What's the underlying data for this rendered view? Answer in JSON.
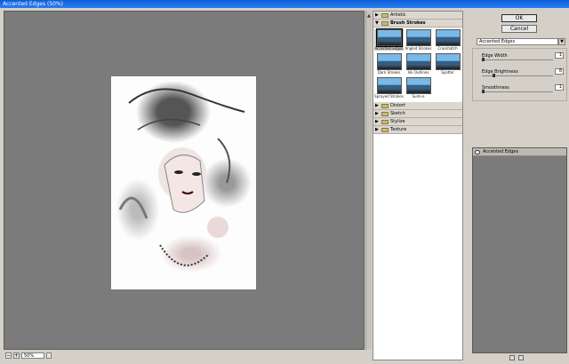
{
  "window": {
    "title": "Accented Edges (50%)"
  },
  "preview": {
    "zoom_minus": "−",
    "zoom_plus": "+",
    "zoom_value": "50%"
  },
  "filters": {
    "categories": [
      {
        "label": "Artistic",
        "expanded": false
      },
      {
        "label": "Brush Strokes",
        "expanded": true
      },
      {
        "label": "Distort",
        "expanded": false
      },
      {
        "label": "Sketch",
        "expanded": false
      },
      {
        "label": "Stylize",
        "expanded": false
      },
      {
        "label": "Texture",
        "expanded": false
      }
    ],
    "brush_strokes": [
      {
        "label": "Accented Edges",
        "selected": true
      },
      {
        "label": "Angled Strokes",
        "selected": false
      },
      {
        "label": "Crosshatch",
        "selected": false
      },
      {
        "label": "Dark Strokes",
        "selected": false
      },
      {
        "label": "Ink Outlines",
        "selected": false
      },
      {
        "label": "Spatter",
        "selected": false
      },
      {
        "label": "Sprayed Strokes",
        "selected": false
      },
      {
        "label": "Sumi-e",
        "selected": false
      }
    ]
  },
  "buttons": {
    "ok": "OK",
    "cancel": "Cancel"
  },
  "settings": {
    "selected_filter": "Accented Edges",
    "dropdown_icon": "chevron-down-icon",
    "params": [
      {
        "label": "Edge Width",
        "value": "1",
        "fraction": 0.0
      },
      {
        "label": "Edge Brightness",
        "value": "8",
        "fraction": 0.16
      },
      {
        "label": "Smoothness",
        "value": "1",
        "fraction": 0.0
      }
    ]
  },
  "layers": {
    "items": [
      {
        "label": "Accented Edges",
        "visible": true
      }
    ]
  }
}
